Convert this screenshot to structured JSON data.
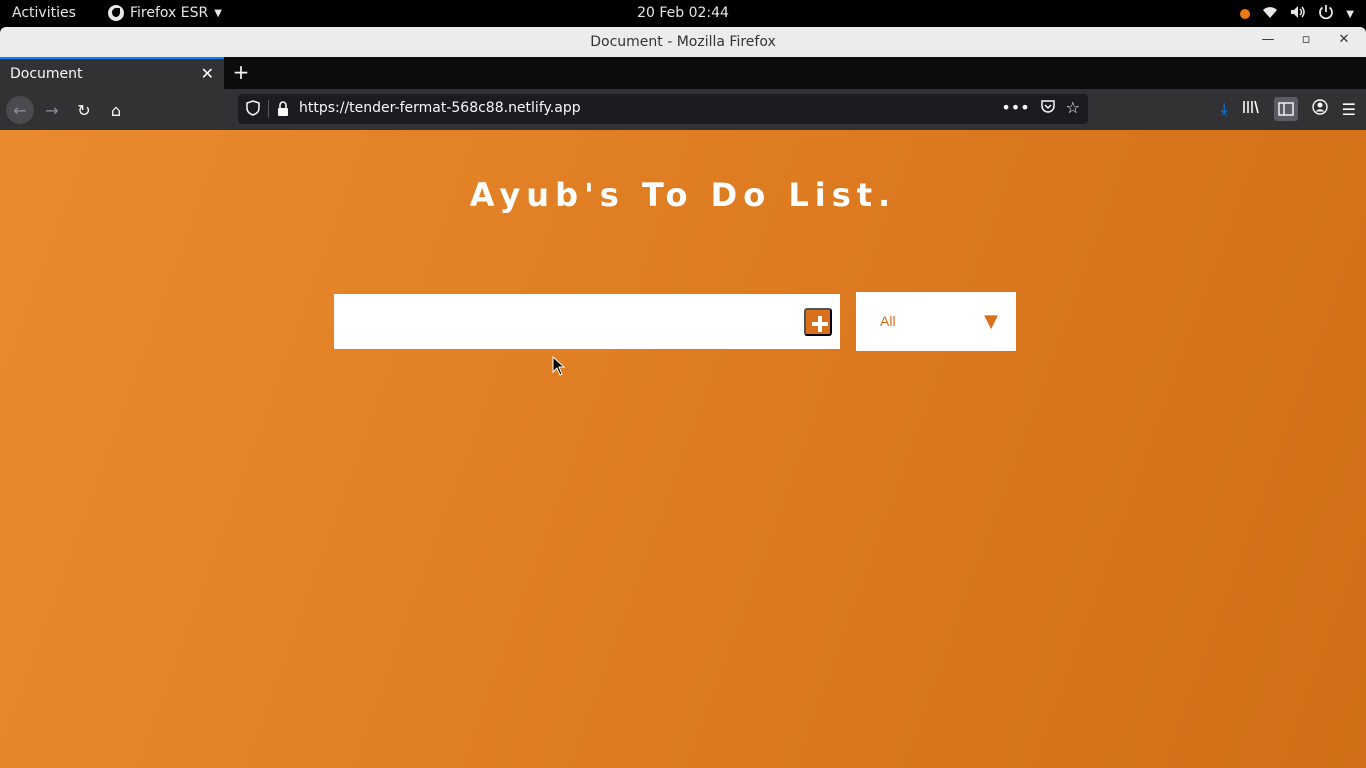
{
  "system": {
    "activities": "Activities",
    "app_name": "Firefox ESR",
    "clock": "20 Feb  02:44"
  },
  "window": {
    "title": "Document - Mozilla Firefox"
  },
  "tabs": [
    {
      "title": "Document"
    }
  ],
  "navbar": {
    "url": "https://tender-fermat-568c88.netlify.app"
  },
  "page": {
    "title": "Ayub's To Do List.",
    "todo_input_value": "",
    "filter_selected": "All"
  },
  "colors": {
    "accent": "#d9701a",
    "background_start": "#ea8a2e",
    "background_end": "#d06d16"
  }
}
